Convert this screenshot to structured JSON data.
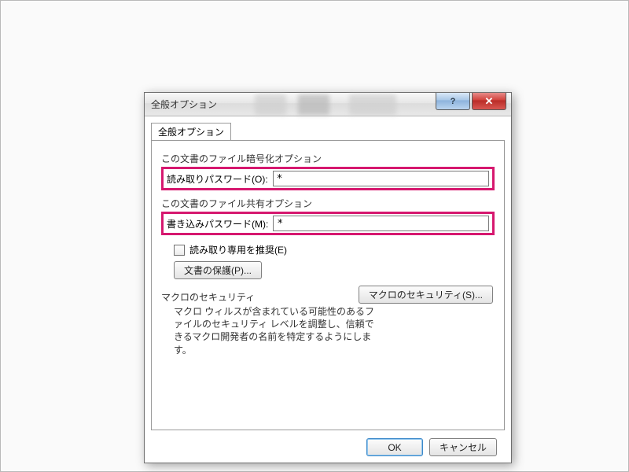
{
  "dialog": {
    "title": "全般オプション",
    "help_symbol": "?",
    "close_symbol": "✕"
  },
  "tab": {
    "label": "全般オプション"
  },
  "encryption": {
    "group_label": "この文書のファイル暗号化オプション",
    "read_password_label": "読み取りパスワード(O):",
    "read_password_value": "*"
  },
  "sharing": {
    "group_label": "この文書のファイル共有オプション",
    "write_password_label": "書き込みパスワード(M):",
    "write_password_value": "*"
  },
  "readonly": {
    "checkbox_label": "読み取り専用を推奨(E)",
    "checked": false
  },
  "protect_button": "文書の保護(P)...",
  "macro": {
    "group_label": "マクロのセキュリティ",
    "description": "マクロ ウィルスが含まれている可能性のあるファイルのセキュリティ レベルを調整し、信頼できるマクロ開発者の名前を特定するようにします。",
    "button": "マクロのセキュリティ(S)..."
  },
  "footer": {
    "ok": "OK",
    "cancel": "キャンセル"
  }
}
